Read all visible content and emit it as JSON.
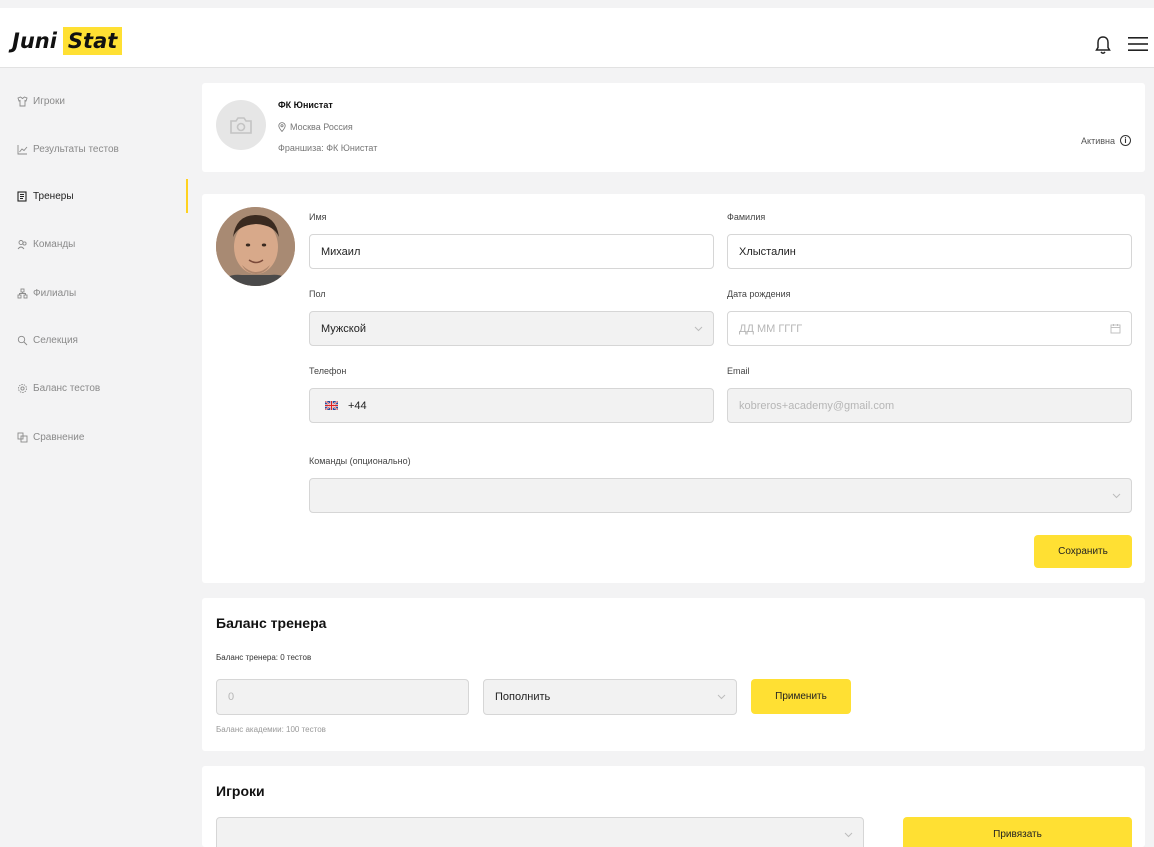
{
  "header": {
    "logo_part1": "Juni",
    "logo_part2": "Stat",
    "accent": "#ffe033",
    "icons": [
      "bell-icon",
      "menu-icon"
    ]
  },
  "sidebar": {
    "items": [
      {
        "label": "Игроки",
        "icon": "players-icon",
        "active": false
      },
      {
        "label": "Результаты тестов",
        "icon": "chart-icon",
        "active": false
      },
      {
        "label": "Тренеры",
        "icon": "coaches-icon",
        "active": true
      },
      {
        "label": "Команды",
        "icon": "teams-icon",
        "active": false
      },
      {
        "label": "Филиалы",
        "icon": "branches-icon",
        "active": false
      },
      {
        "label": "Селекция",
        "icon": "search-icon",
        "active": false
      },
      {
        "label": "Баланс тестов",
        "icon": "gear-icon",
        "active": false
      },
      {
        "label": "Сравнение",
        "icon": "compare-icon",
        "active": false
      }
    ]
  },
  "club": {
    "name": "ФК Юнистат",
    "location": "Москва Россия",
    "franchise": "Франшиза: ФК Юнистат",
    "status": "Активна"
  },
  "form": {
    "first_name_label": "Имя",
    "first_name_value": "Михаил",
    "last_name_label": "Фамилия",
    "last_name_value": "Хлысталин",
    "gender_label": "Пол",
    "gender_value": "Мужской",
    "birth_label": "Дата рождения",
    "birth_placeholder": "ДД ММ ГГГГ",
    "phone_label": "Телефон",
    "phone_value": "+44",
    "email_label": "Email",
    "email_value": "kobreros+academy@gmail.com",
    "teams_label": "Команды (опционально)",
    "teams_value": "",
    "save_label": "Сохранить"
  },
  "balance": {
    "title": "Баланс тренера",
    "subtitle": "Баланс тренера: 0 тестов",
    "amount_placeholder": "0",
    "action_value": "Пополнить",
    "apply_label": "Применить",
    "academy_balance": "Баланс академии: 100 тестов"
  },
  "players": {
    "title": "Игроки",
    "select_value": "",
    "bind_label": "Привязать"
  }
}
